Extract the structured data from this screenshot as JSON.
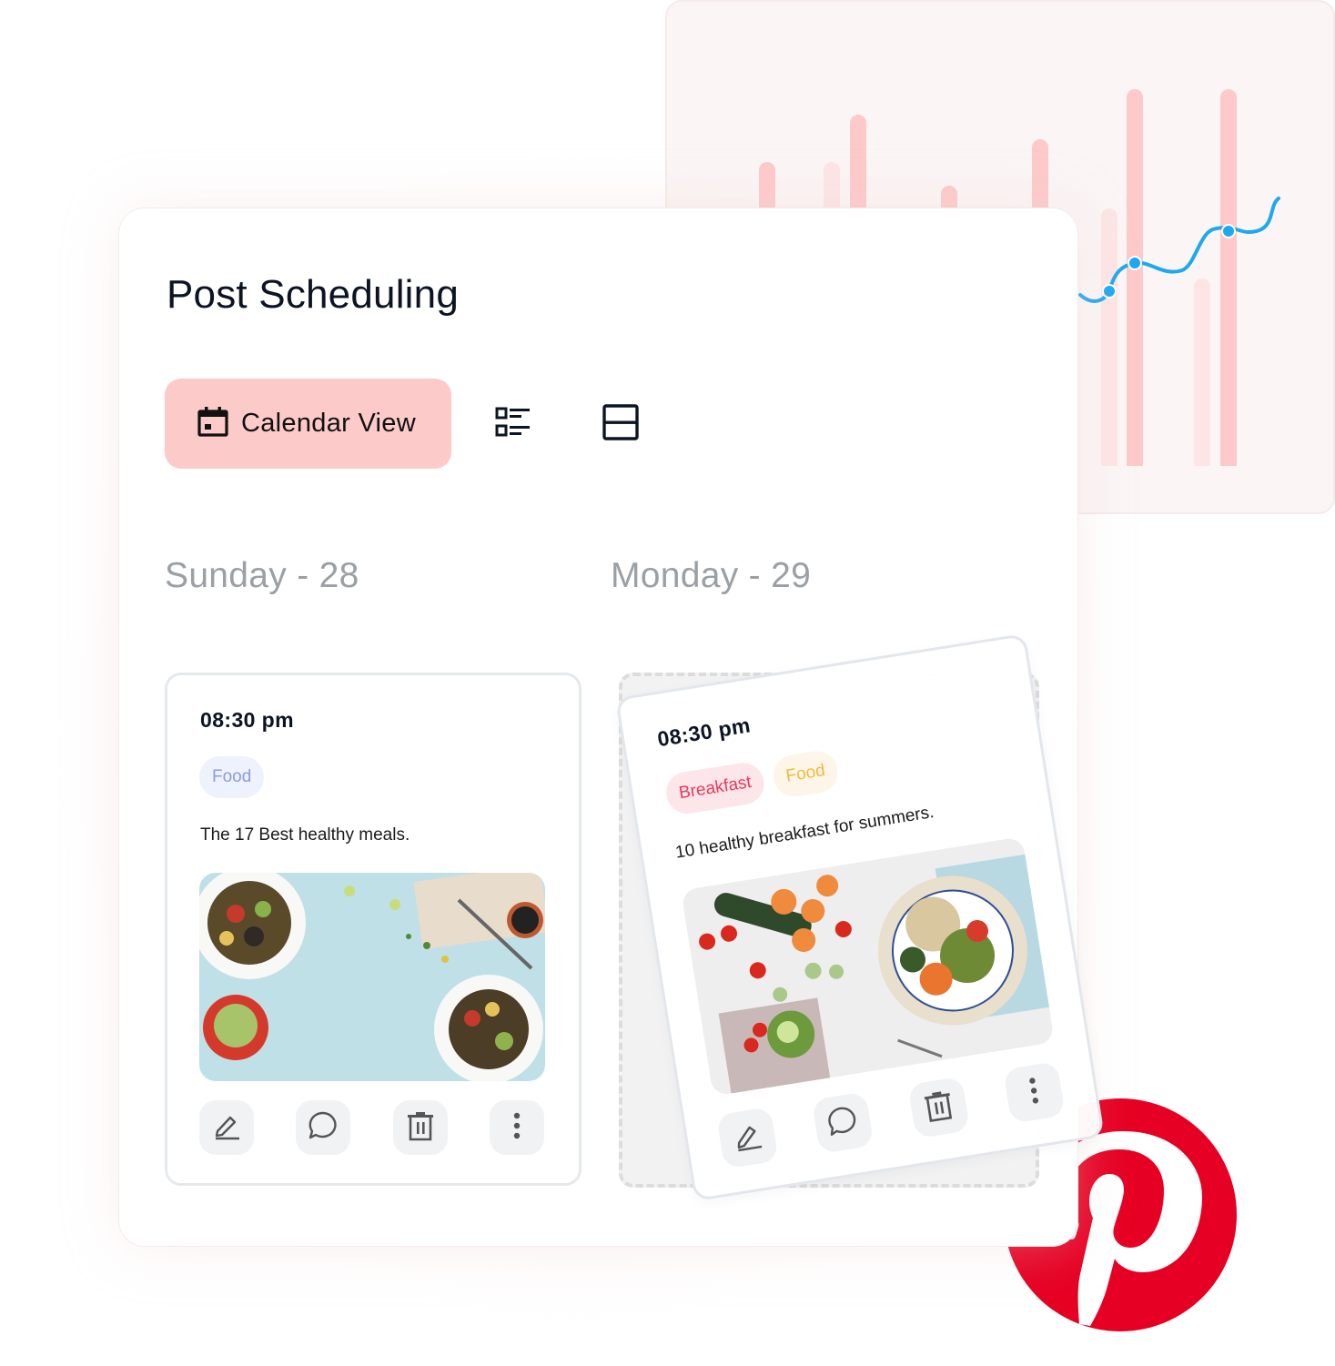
{
  "page": {
    "title": "Post Scheduling"
  },
  "toolbar": {
    "calendar_view_label": "Calendar View",
    "active_view": "calendar",
    "icons": [
      "calendar-icon",
      "list-view-icon",
      "split-view-icon"
    ]
  },
  "days": [
    {
      "label": "Sunday - 28"
    },
    {
      "label": "Monday - 29"
    }
  ],
  "posts": [
    {
      "time": "08:30 pm",
      "tags": [
        {
          "label": "Food",
          "color": "#8b9be0",
          "bg": "#eef2fd"
        }
      ],
      "description": "The 17 Best healthy meals.",
      "image": "salad-bowls-on-blue-table",
      "actions": [
        "edit",
        "comment",
        "delete",
        "more"
      ]
    },
    {
      "time": "08:30 pm",
      "tags": [
        {
          "label": "Breakfast",
          "color": "#e8395b",
          "bg": "#fde6ea"
        },
        {
          "label": "Food",
          "color": "#f1b93c",
          "bg": "#fdf6e8"
        }
      ],
      "description": "10 healthy breakfast for summers.",
      "image": "vegetable-quinoa-bowl-on-marble",
      "actions": [
        "edit",
        "comment",
        "delete",
        "more"
      ],
      "state": "dragging"
    }
  ],
  "background_chart": {
    "bar_color": "#fdc9c9",
    "bar_faded_color": "#fde6e6",
    "line_color": "#1ea9ef"
  },
  "brand": {
    "logo": "pinterest-logo",
    "color": "#e60023"
  },
  "colors": {
    "accent": "#fdcaca",
    "title": "#0c1424",
    "muted": "#9aa0a6",
    "icon": "#555555"
  }
}
